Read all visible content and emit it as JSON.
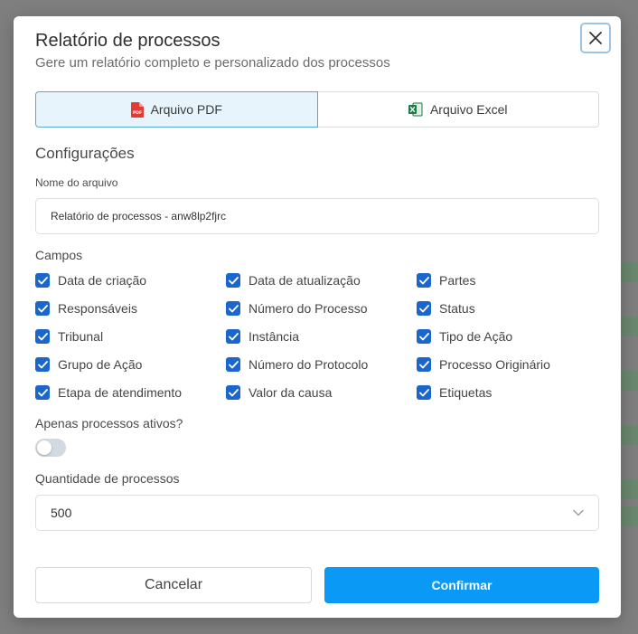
{
  "modal": {
    "title": "Relatório de processos",
    "subtitle": "Gere um relatório completo e personalizado dos processos"
  },
  "tabs": [
    {
      "label": "Arquivo PDF",
      "icon": "pdf-file-icon",
      "active": true
    },
    {
      "label": "Arquivo Excel",
      "icon": "excel-file-icon",
      "active": false
    }
  ],
  "config": {
    "section_title": "Configurações",
    "filename_label": "Nome do arquivo",
    "filename_value": "Relatório de processos - anw8lp2fjrc",
    "fields_label": "Campos",
    "fields": [
      {
        "label": "Data de criação",
        "checked": true
      },
      {
        "label": "Data de atualização",
        "checked": true
      },
      {
        "label": "Partes",
        "checked": true
      },
      {
        "label": "Responsáveis",
        "checked": true
      },
      {
        "label": "Número do Processo",
        "checked": true
      },
      {
        "label": "Status",
        "checked": true
      },
      {
        "label": "Tribunal",
        "checked": true
      },
      {
        "label": "Instância",
        "checked": true
      },
      {
        "label": "Tipo de Ação",
        "checked": true
      },
      {
        "label": "Grupo de Ação",
        "checked": true
      },
      {
        "label": "Número do Protocolo",
        "checked": true
      },
      {
        "label": "Processo Originário",
        "checked": true
      },
      {
        "label": "Etapa de atendimento",
        "checked": true
      },
      {
        "label": "Valor da causa",
        "checked": true
      },
      {
        "label": "Etiquetas",
        "checked": true
      }
    ],
    "active_only_label": "Apenas processos ativos?",
    "active_only": false,
    "quantity_label": "Quantidade de processos",
    "quantity_value": "500"
  },
  "actions": {
    "cancel_label": "Cancelar",
    "confirm_label": "Confirmar"
  },
  "colors": {
    "accent": "#0a99f5",
    "checkbox": "#1a66cc",
    "active_tab_bg": "#e8f4fc",
    "pdf_red": "#e53935",
    "excel_green": "#1d7a45"
  }
}
